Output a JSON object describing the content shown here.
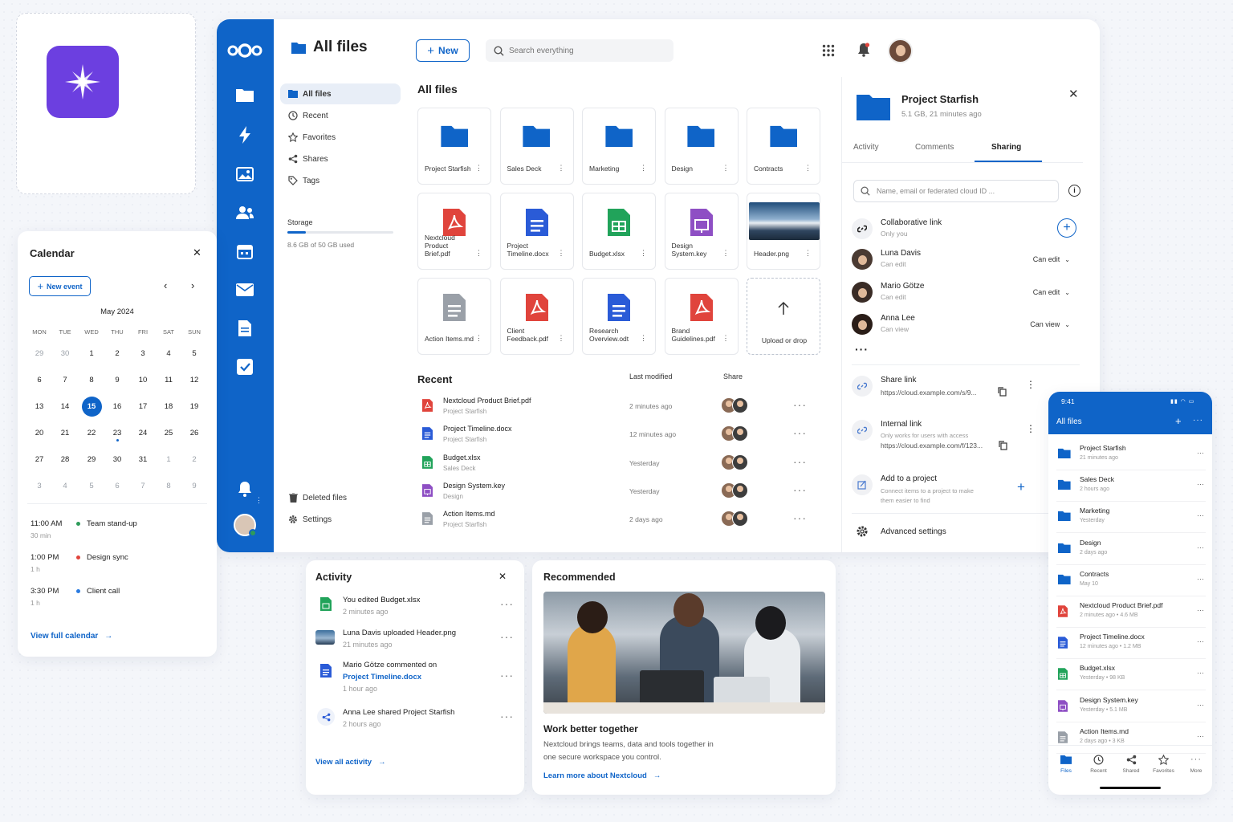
{
  "logo": {
    "icon": "sparkle-icon",
    "color": "#6c3fe0"
  },
  "app": {
    "title": "All files",
    "new_label": "New",
    "search_placeholder": "Search everything",
    "sidebar": [
      {
        "label": "All files",
        "icon": "folder-icon"
      },
      {
        "label": "Recent",
        "icon": "clock-icon"
      },
      {
        "label": "Favorites",
        "icon": "star-icon"
      },
      {
        "label": "Shares",
        "icon": "share-icon"
      },
      {
        "label": "Tags",
        "icon": "tag-icon"
      }
    ],
    "storage_label": "Storage",
    "storage_used": "8.6 GB of 50 GB used",
    "storage_fraction": 0.172,
    "deleted_label": "Deleted files",
    "settings_label": "Settings",
    "grid_title": "All files",
    "tiles": [
      {
        "name": "Project Starfish",
        "kind": "folder"
      },
      {
        "name": "Sales Deck",
        "kind": "folder"
      },
      {
        "name": "Marketing",
        "kind": "folder"
      },
      {
        "name": "Design",
        "kind": "folder"
      },
      {
        "name": "Contracts",
        "kind": "folder"
      },
      {
        "name": "Nextcloud Product Brief.pdf",
        "kind": "pdf"
      },
      {
        "name": "Project Timeline.docx",
        "kind": "doc"
      },
      {
        "name": "Budget.xlsx",
        "kind": "sheet"
      },
      {
        "name": "Design System.key",
        "kind": "key"
      },
      {
        "name": "Header.png",
        "kind": "image"
      },
      {
        "name": "Action Items.md",
        "kind": "md"
      },
      {
        "name": "Client Feedback.pdf",
        "kind": "pdf"
      },
      {
        "name": "Research Overview.odt",
        "kind": "doc"
      },
      {
        "name": "Brand Guidelines.pdf",
        "kind": "pdf"
      },
      {
        "name": "Upload or drop",
        "kind": "upload"
      }
    ],
    "recent_title": "Recent",
    "col_modified": "Last modified",
    "col_share": "Share",
    "recent": [
      {
        "name": "Nextcloud Product Brief.pdf",
        "folder": "Project Starfish",
        "time": "2 minutes ago",
        "kind": "pdf"
      },
      {
        "name": "Project Timeline.docx",
        "folder": "Project Starfish",
        "time": "12 minutes ago",
        "kind": "doc"
      },
      {
        "name": "Budget.xlsx",
        "folder": "Sales Deck",
        "time": "Yesterday",
        "kind": "sheet"
      },
      {
        "name": "Design System.key",
        "folder": "Design",
        "time": "Yesterday",
        "kind": "key"
      },
      {
        "name": "Action Items.md",
        "folder": "Project Starfish",
        "time": "2 days ago",
        "kind": "md"
      }
    ]
  },
  "details": {
    "title": "Project Starfish",
    "meta": "5.1 GB, 21 minutes ago",
    "tabs": [
      "Activity",
      "Comments",
      "Sharing"
    ],
    "share_placeholder": "Name, email or federated cloud ID ...",
    "collab_title": "Collaborative link",
    "collab_sub": "Only you",
    "people": [
      {
        "name": "Luna Davis",
        "role": "Can edit",
        "perm": "Can edit"
      },
      {
        "name": "Mario Götze",
        "role": "Can edit",
        "perm": "Can edit"
      },
      {
        "name": "Anna Lee",
        "role": "Can view",
        "perm": "Can view"
      }
    ],
    "share_link_title": "Share link",
    "share_link_url": "https://cloud.example.com/s/9...",
    "internal_title": "Internal link",
    "internal_sub": "Only works for users with access",
    "internal_url": "https://cloud.example.com/f/123...",
    "project_title": "Add to a project",
    "project_sub1": "Connect items to a project to make",
    "project_sub2": "them easier to find",
    "advanced": "Advanced settings"
  },
  "calendar": {
    "title": "Calendar",
    "new_event": "New event",
    "month": "May 2024",
    "weekdays": [
      "MON",
      "TUE",
      "WED",
      "THU",
      "FRI",
      "SAT",
      "SUN"
    ],
    "weeks": [
      [
        "29",
        "30",
        "1",
        "2",
        "3",
        "4",
        "5"
      ],
      [
        "6",
        "7",
        "8",
        "9",
        "10",
        "11",
        "12"
      ],
      [
        "13",
        "14",
        "15",
        "16",
        "17",
        "18",
        "19"
      ],
      [
        "20",
        "21",
        "22",
        "23",
        "24",
        "25",
        "26"
      ],
      [
        "27",
        "28",
        "29",
        "30",
        "31",
        "1",
        "2"
      ],
      [
        "3",
        "4",
        "5",
        "6",
        "7",
        "8",
        "9"
      ]
    ],
    "today": "15",
    "events": [
      {
        "time": "11:00 AM",
        "dur": "30 min",
        "title": "Team stand-up",
        "color": "#2e9b5a"
      },
      {
        "time": "1:00 PM",
        "dur": "1 h",
        "title": "Design sync",
        "color": "#e0443c"
      },
      {
        "time": "3:30 PM",
        "dur": "1 h",
        "title": "Client call",
        "color": "#2a7be0"
      }
    ],
    "view_full": "View full calendar"
  },
  "activity": {
    "title": "Activity",
    "items": [
      {
        "pre": "You edited ",
        "bold": "Budget.xlsx",
        "time": "2 minutes ago"
      },
      {
        "pre": "Luna Davis uploaded Header.png",
        "bold": "",
        "time": "21 minutes ago"
      },
      {
        "pre": "Mario Götze commented on",
        "link": "Project Timeline.docx",
        "time": "1 hour ago"
      },
      {
        "pre": "Anna Lee shared Project Starfish",
        "bold": "",
        "time": "2 hours ago"
      }
    ],
    "view_all": "View all activity"
  },
  "recommended": {
    "title": "Recommended",
    "headline": "Work better together",
    "body1": "Nextcloud brings teams, data and tools together in",
    "body2": "one secure workspace you control.",
    "link": "Learn more about Nextcloud"
  },
  "phone": {
    "time": "9:41",
    "title": "All files",
    "rows": [
      {
        "name": "Project Starfish",
        "sub": "21 minutes ago",
        "kind": "folder"
      },
      {
        "name": "Sales Deck",
        "sub": "2 hours ago",
        "kind": "folder"
      },
      {
        "name": "Marketing",
        "sub": "Yesterday",
        "kind": "folder"
      },
      {
        "name": "Design",
        "sub": "2 days ago",
        "kind": "folder"
      },
      {
        "name": "Contracts",
        "sub": "May 10",
        "kind": "folder"
      },
      {
        "name": "Nextcloud Product Brief.pdf",
        "sub": "2 minutes ago  •  4.6 MB",
        "kind": "pdf"
      },
      {
        "name": "Project Timeline.docx",
        "sub": "12 minutes ago  •  1.2 MB",
        "kind": "doc"
      },
      {
        "name": "Budget.xlsx",
        "sub": "Yesterday  •  98 KB",
        "kind": "sheet"
      },
      {
        "name": "Design System.key",
        "sub": "Yesterday  •  5.1 MB",
        "kind": "key"
      },
      {
        "name": "Action Items.md",
        "sub": "2 days ago  •  3 KB",
        "kind": "md"
      }
    ],
    "nav": [
      "Files",
      "Recent",
      "Shared",
      "Favorites",
      "More"
    ]
  },
  "colors": {
    "brand": "#0f64c8",
    "pdf": "#e0443c",
    "doc": "#2a5bd7",
    "sheet": "#21a35a",
    "key": "#8e4fc4"
  }
}
